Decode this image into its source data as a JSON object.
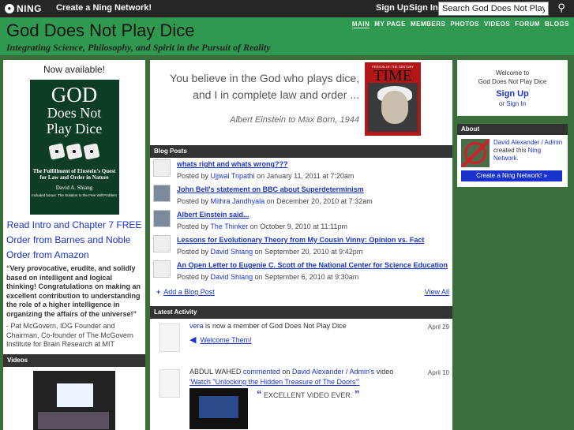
{
  "ningbar": {
    "logo": "NING",
    "create": "Create a Ning Network!",
    "signup": "Sign Up",
    "signin": "Sign In",
    "search_value": "Search God Does Not Play Dice",
    "search_icon": "search-icon"
  },
  "header": {
    "title": "God Does Not Play Dice",
    "tagline": "Integrating Science, Philosophy, and Spirit in the Pursuit of Reality",
    "nav": [
      "MAIN",
      "MY PAGE",
      "MEMBERS",
      "PHOTOS",
      "VIDEOS",
      "FORUM",
      "BLOGS"
    ]
  },
  "left": {
    "now_available": "Now available!",
    "book": {
      "title1": "GOD",
      "title2": "Does Not",
      "title3": "Play Dice",
      "subtitle": "The Fulfillment of Einstein's Quest for Law and Order in Nature",
      "author": "David A. Shiang",
      "tiny": "Included bonus: The Solution to the Free Will Problem"
    },
    "link_intro": "Read Intro and Chapter 7 FREE",
    "link_bn": "Order from Barnes and Noble",
    "link_amazon": "Order from Amazon",
    "quote": "“Very provocative, erudite, and solidly based on intelligent and logical thinking! Congratulations on making an excellent contribution to understanding the role of a higher intelligence in organizing the affairs of the universe!”",
    "quote_by": "- Pat McGovern, IDG Founder and Chairman, Co-founder of The McGovern Institute for Brain Research at MIT",
    "videos_head": "Videos"
  },
  "hero": {
    "line1": "You believe in the God who plays dice,",
    "line2": "and I in complete law and order ...",
    "cite": "Albert Einstein to Max Born, 1944",
    "time_label": "PERSON OF THE CENTURY",
    "time_word": "TIME"
  },
  "blog": {
    "head": "Blog Posts",
    "posts": [
      {
        "title": "whats right and whats wrong???",
        "by": "Posted by",
        "author": "Ujjwal Tripathi",
        "date": "on January 11, 2011 at 7:20am"
      },
      {
        "title": "John Bell's statement on BBC about Superdeterminism",
        "by": "Posted by",
        "author": "Mithra Jandhyala",
        "date": "on December 20, 2010 at 7:32am"
      },
      {
        "title": "Albert Einstein said...",
        "by": "Posted by",
        "author": "The Thinker",
        "date": "on October 9, 2010 at 11:11pm"
      },
      {
        "title": "Lessons for Evolutionary Theory from My Cousin Vinny: Opinion vs. Fact",
        "by": "Posted by",
        "author": "David Shiang",
        "date": "on September 20, 2010 at 9:42pm"
      },
      {
        "title": "An Open Letter to Eugenie C. Scott of the National Center for Science Education",
        "by": "Posted by",
        "author": "David Shiang",
        "date": "on September 6, 2010 at 9:30am"
      }
    ],
    "add": "Add a Blog Post",
    "view_all": "View All"
  },
  "activity": {
    "head": "Latest Activity",
    "a1": {
      "user": "vera",
      "text": " is now a member of God Does Not Play Dice",
      "date": "April 29",
      "welcome": "Welcome Them!"
    },
    "a2": {
      "user": "ABDUL WAHED",
      "verb": "commented",
      "on": " on ",
      "target": "David Alexander / Admin's",
      "tail": " video",
      "date": "April 10",
      "watch": "'Watch \"Unlocking the Hidden Treasure of The Doors\"'",
      "comment": "EXCELLENT VIDEO EVER."
    }
  },
  "right": {
    "welcome1": "Welcome to",
    "welcome2": "God Does Not Play Dice",
    "signup": "Sign Up",
    "or": "or ",
    "signin": "Sign In",
    "about_head": "About",
    "about_user": "David Alexander / Admin",
    "about_created": " created this ",
    "about_network": "Ning Network",
    "about_dot": ".",
    "create_btn": "Create a Ning Network! »"
  }
}
